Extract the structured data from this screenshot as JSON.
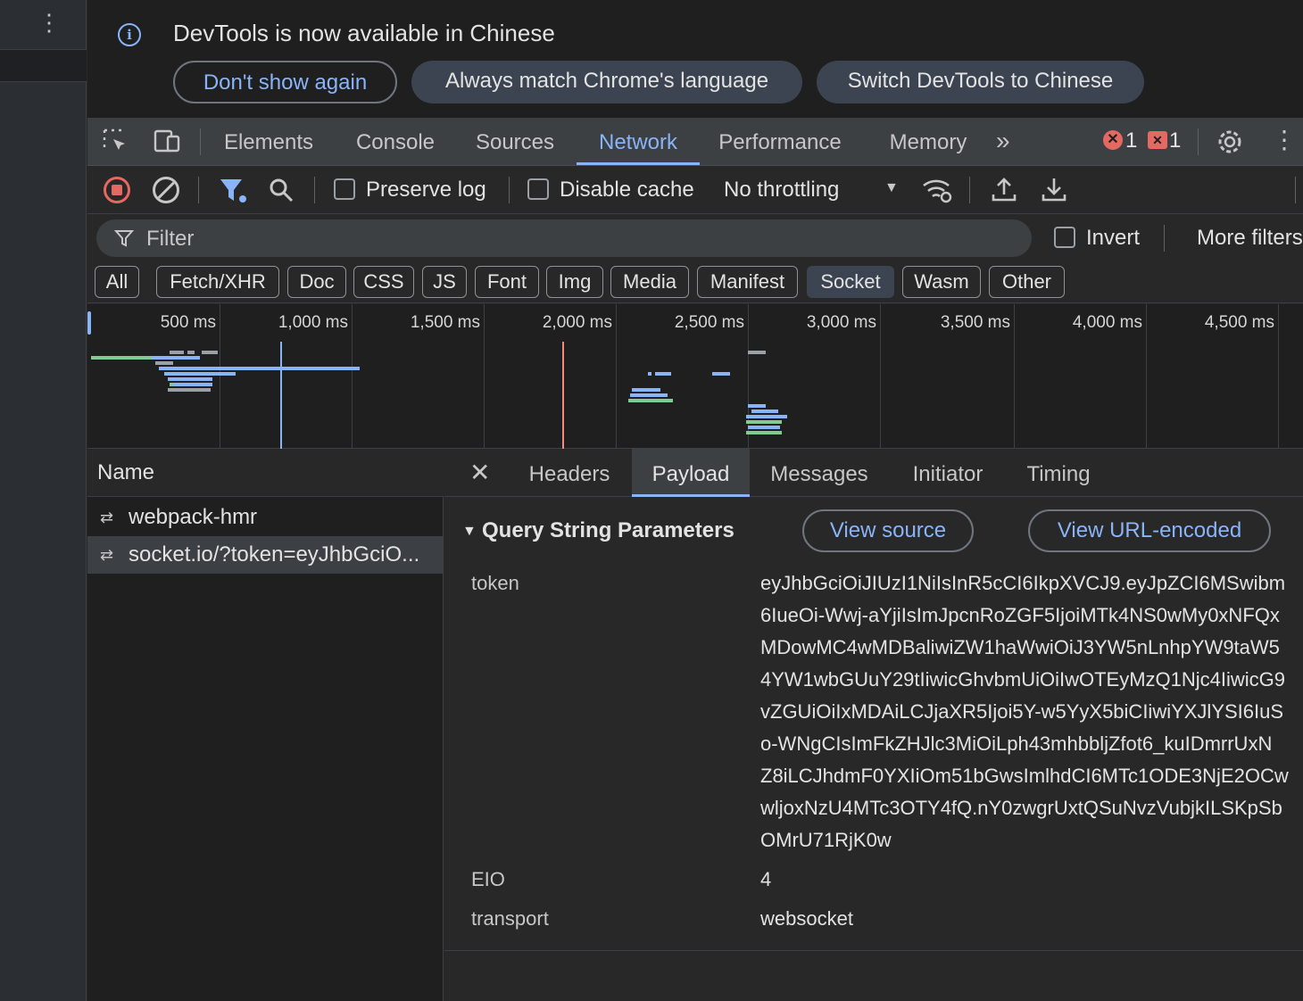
{
  "infobar": {
    "message": "DevTools is now available in Chinese",
    "buttons": [
      "Don't show again",
      "Always match Chrome's language",
      "Switch DevTools to Chinese"
    ]
  },
  "tabs": [
    "Elements",
    "Console",
    "Sources",
    "Network",
    "Performance",
    "Memory"
  ],
  "active_tab": "Network",
  "status": {
    "errors": "1",
    "issues": "1"
  },
  "toolbar": {
    "preserve_log": "Preserve log",
    "disable_cache": "Disable cache",
    "throttling": "No throttling"
  },
  "filter": {
    "placeholder": "Filter",
    "invert": "Invert",
    "more_filters": "More filters"
  },
  "type_filters": [
    "All",
    "Fetch/XHR",
    "Doc",
    "CSS",
    "JS",
    "Font",
    "Img",
    "Media",
    "Manifest",
    "Socket",
    "Wasm",
    "Other"
  ],
  "active_type_filter": "Socket",
  "timeline_labels": [
    "500 ms",
    "1,000 ms",
    "1,500 ms",
    "2,000 ms",
    "2,500 ms",
    "3,000 ms",
    "3,500 ms",
    "4,000 ms",
    "4,500 ms"
  ],
  "requests": {
    "header": "Name",
    "items": [
      "webpack-hmr",
      "socket.io/?token=eyJhbGciO..."
    ]
  },
  "detail_tabs": [
    "Headers",
    "Payload",
    "Messages",
    "Initiator",
    "Timing"
  ],
  "active_detail_tab": "Payload",
  "payload": {
    "section_title": "Query String Parameters",
    "view_source": "View source",
    "view_url_encoded": "View URL-encoded",
    "params": [
      {
        "key": "token",
        "lines": [
          "eyJhbGciOiJIUzI1NiIsInR5cCI6IkpXVCJ9.eyJpZCI6MSwibm",
          "6IueOi-Wwj-aYjiIsImJpcnRoZGF5IjoiMTk4NS0wMy0xNFQx",
          "MDowMC4wMDBaliwiZW1haWwiOiJ3YW5nLnhpYW9taW5",
          "4YW1wbGUuY29tIiwicGhvbmUiOiIwOTEyMzQ1Njc4IiwicG9",
          "vZGUiOiIxMDAiLCJjaXR5Ijoi5Y-w5YyX5biCIiwiYXJlYSI6IuS",
          "o-WNgCIsImFkZHJlc3MiOiLph43mhbbljZfot6_kuIDmrrUxN",
          "Z8iLCJhdmF0YXIiOm51bGwsImlhdCI6MTc1ODE3NjE2OCw",
          "wljoxNzU4MTc3OTY4fQ.nY0zwgrUxtQSuNvzVubjkILSKpSb",
          "OMrU71RjK0w"
        ]
      },
      {
        "key": "EIO",
        "value": "4"
      },
      {
        "key": "transport",
        "value": "websocket"
      }
    ]
  }
}
